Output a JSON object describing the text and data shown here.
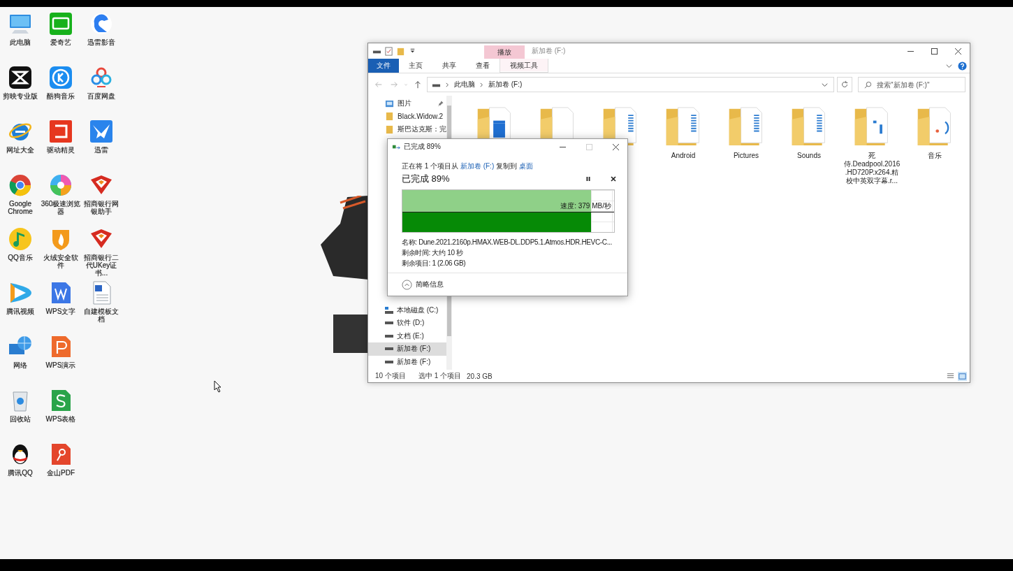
{
  "desktop": {
    "shortcuts": [
      {
        "label": "此电脑",
        "kind": "computer"
      },
      {
        "label": "剪映专业版",
        "kind": "capcut"
      },
      {
        "label": "网址大全",
        "kind": "ie"
      },
      {
        "label": "Google Chrome",
        "kind": "chrome"
      },
      {
        "label": "QQ音乐",
        "kind": "qqmusic"
      },
      {
        "label": "腾讯视频",
        "kind": "tencent-video"
      },
      {
        "label": "网络",
        "kind": "network"
      },
      {
        "label": "回收站",
        "kind": "recycle-bin"
      },
      {
        "label": "腾讯QQ",
        "kind": "qq"
      },
      {
        "label": "爱奇艺",
        "kind": "iqiyi"
      },
      {
        "label": "酷狗音乐",
        "kind": "kugou"
      },
      {
        "label": "驱动精灵",
        "kind": "driver"
      },
      {
        "label": "360极速浏览器",
        "kind": "browser360"
      },
      {
        "label": "火绒安全软件",
        "kind": "huorong"
      },
      {
        "label": "WPS文字",
        "kind": "wps-writer"
      },
      {
        "label": "WPS演示",
        "kind": "wps-slides"
      },
      {
        "label": "WPS表格",
        "kind": "wps-sheets"
      },
      {
        "label": "金山PDF",
        "kind": "pdf"
      },
      {
        "label": "迅雷影音",
        "kind": "thunder-player"
      },
      {
        "label": "百度网盘",
        "kind": "baidu-pan"
      },
      {
        "label": "迅雷",
        "kind": "thunder"
      },
      {
        "label": "招商银行网银助手",
        "kind": "bank"
      },
      {
        "label": "招商银行二代UKey证书...",
        "kind": "bank"
      },
      {
        "label": "自建模板文档",
        "kind": "word-doc"
      }
    ]
  },
  "explorer": {
    "context_tab": "播放",
    "title": "新加卷 (F:)",
    "ribbon_tabs": [
      {
        "label": "文件",
        "kind": "file"
      },
      {
        "label": "主页",
        "kind": "normal"
      },
      {
        "label": "共享",
        "kind": "normal"
      },
      {
        "label": "查看",
        "kind": "normal"
      },
      {
        "label": "视频工具",
        "kind": "context"
      }
    ],
    "breadcrumb": [
      "此电脑",
      "新加卷 (F:)"
    ],
    "search": {
      "placeholder": "搜索\"新加卷 (F:)\""
    },
    "nav_top": [
      {
        "label": "图片",
        "kind": "pictures",
        "pinned": true
      },
      {
        "label": "Black.Widow.2",
        "kind": "folder",
        "pinned": false
      },
      {
        "label": "斯巴达克斯：完",
        "kind": "folder",
        "pinned": false
      }
    ],
    "nav_bottom": [
      {
        "label": "本地磁盘 (C:)",
        "kind": "system-drive",
        "selected": false
      },
      {
        "label": "软件 (D:)",
        "kind": "drive",
        "selected": false
      },
      {
        "label": "文档 (E:)",
        "kind": "drive",
        "selected": false
      },
      {
        "label": "新加卷 (F:)",
        "kind": "drive",
        "selected": true
      },
      {
        "label": "新加卷 (F:)",
        "kind": "drive",
        "selected": false
      }
    ],
    "items": [
      {
        "kind": "video"
      },
      {
        "kind": "doc"
      },
      {
        "kind": "files"
      },
      {
        "label": "Android",
        "kind": "files"
      },
      {
        "label": "Pictures",
        "kind": "files"
      },
      {
        "label": "Sounds",
        "kind": "files"
      },
      {
        "label": "死侍.Deadpool.2016.HD720P.x264.精校中英双字幕.r...",
        "kind": "media"
      },
      {
        "label": "音乐",
        "kind": "music"
      }
    ],
    "status": {
      "count": "10 个项目",
      "selection": "选中 1 个项目",
      "size": "20.3 GB"
    }
  },
  "copy_dialog": {
    "title": "已完成 89%",
    "message": {
      "before": "正在将 1 个项目从",
      "source": "新加卷 (F:)",
      "middle": "复制到",
      "destination": "桌面"
    },
    "heading": "已完成 89%",
    "progress": {
      "level": 0.89
    },
    "speed": "速度: 379 MB/秒",
    "details": [
      "名称: Dune.2021.2160p.HMAX.WEB-DL.DDP5.1.Atmos.HDR.HEVC-C...",
      "剩余时间: 大约 10 秒",
      "剩余项目: 1 (2.06 GB)"
    ],
    "toggle": "简略信息"
  }
}
